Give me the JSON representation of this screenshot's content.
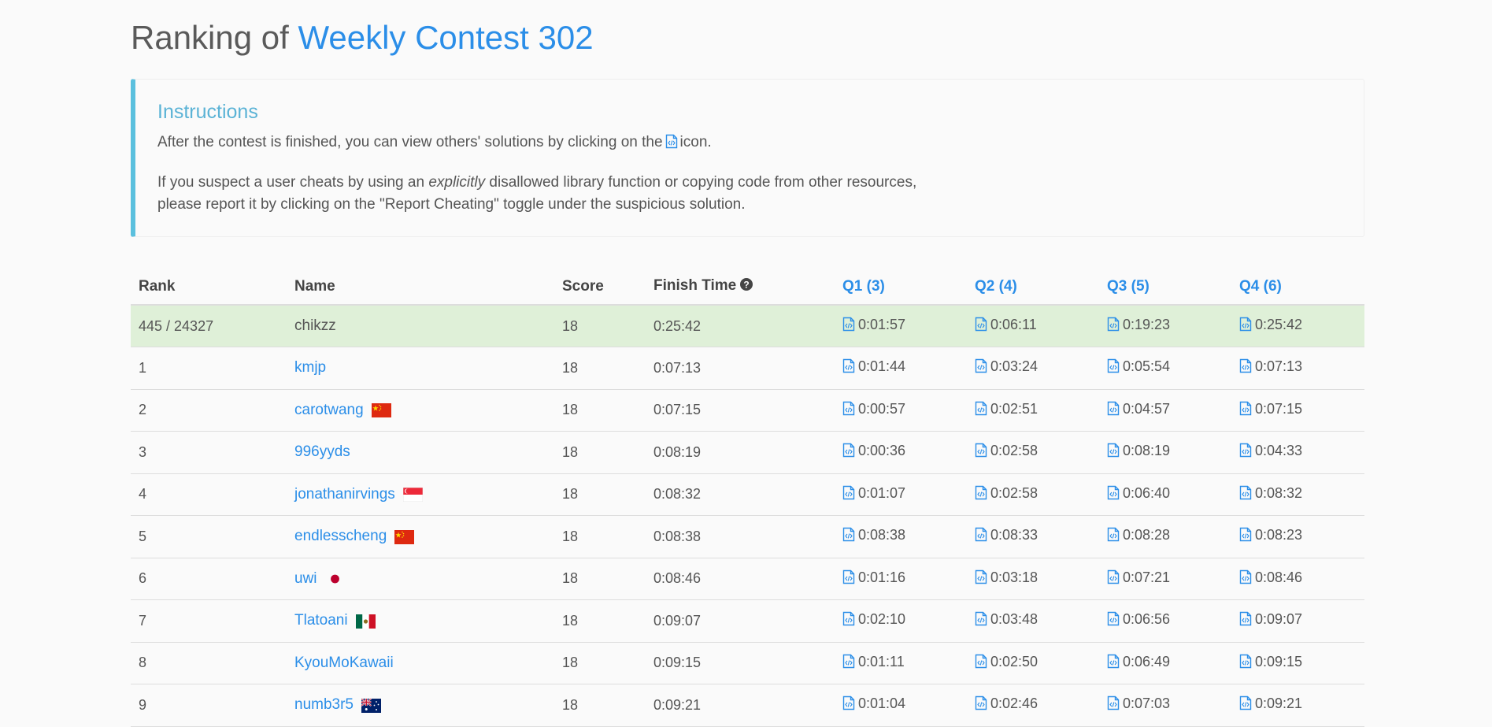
{
  "header": {
    "title_prefix": "Ranking of",
    "contest_name": "Weekly Contest 302"
  },
  "instructions": {
    "heading": "Instructions",
    "line1_before": "After the contest is finished, you can view others' solutions by clicking on the",
    "line1_after": "icon.",
    "line2_part1": "If you suspect a user cheats by using an",
    "line2_emph": "explicitly",
    "line2_part2": "disallowed library function or copying code from other resources,",
    "line3": "please report it by clicking on the \"Report Cheating\" toggle under the suspicious solution."
  },
  "table": {
    "headers": {
      "rank": "Rank",
      "name": "Name",
      "score": "Score",
      "finish_time": "Finish Time",
      "q1": "Q1 (3)",
      "q2": "Q2 (4)",
      "q3": "Q3 (5)",
      "q4": "Q4 (6)"
    },
    "my_row": {
      "rank": "445 / 24327",
      "name": "chikzz",
      "score": "18",
      "finish_time": "0:25:42",
      "q": [
        "0:01:57",
        "0:06:11",
        "0:19:23",
        "0:25:42"
      ]
    },
    "rows": [
      {
        "rank": "1",
        "name": "kmjp",
        "flag": "",
        "score": "18",
        "finish_time": "0:07:13",
        "q": [
          "0:01:44",
          "0:03:24",
          "0:05:54",
          "0:07:13"
        ]
      },
      {
        "rank": "2",
        "name": "carotwang",
        "flag": "cn-flag-icon",
        "score": "18",
        "finish_time": "0:07:15",
        "q": [
          "0:00:57",
          "0:02:51",
          "0:04:57",
          "0:07:15"
        ]
      },
      {
        "rank": "3",
        "name": "996yyds",
        "flag": "",
        "score": "18",
        "finish_time": "0:08:19",
        "q": [
          "0:00:36",
          "0:02:58",
          "0:08:19",
          "0:04:33"
        ]
      },
      {
        "rank": "4",
        "name": "jonathanirvings",
        "flag": "sg-flag-icon",
        "score": "18",
        "finish_time": "0:08:32",
        "q": [
          "0:01:07",
          "0:02:58",
          "0:06:40",
          "0:08:32"
        ]
      },
      {
        "rank": "5",
        "name": "endlesscheng",
        "flag": "cn-flag-icon",
        "score": "18",
        "finish_time": "0:08:38",
        "q": [
          "0:08:38",
          "0:08:33",
          "0:08:28",
          "0:08:23"
        ]
      },
      {
        "rank": "6",
        "name": "uwi",
        "flag": "jp-flag-icon",
        "score": "18",
        "finish_time": "0:08:46",
        "q": [
          "0:01:16",
          "0:03:18",
          "0:07:21",
          "0:08:46"
        ]
      },
      {
        "rank": "7",
        "name": "Tlatoani",
        "flag": "mx-flag-icon",
        "score": "18",
        "finish_time": "0:09:07",
        "q": [
          "0:02:10",
          "0:03:48",
          "0:06:56",
          "0:09:07"
        ]
      },
      {
        "rank": "8",
        "name": "KyouMoKawaii",
        "flag": "",
        "score": "18",
        "finish_time": "0:09:15",
        "q": [
          "0:01:11",
          "0:02:50",
          "0:06:49",
          "0:09:15"
        ]
      },
      {
        "rank": "9",
        "name": "numb3r5",
        "flag": "au-flag-icon",
        "score": "18",
        "finish_time": "0:09:21",
        "q": [
          "0:01:04",
          "0:02:46",
          "0:07:03",
          "0:09:21"
        ]
      }
    ]
  },
  "colors": {
    "accent": "#2b8ee8",
    "info_border": "#5bc0de",
    "my_row_bg": "#dff0d8"
  },
  "icons": {
    "solution": "code-file-icon",
    "help": "question-circle-icon"
  }
}
